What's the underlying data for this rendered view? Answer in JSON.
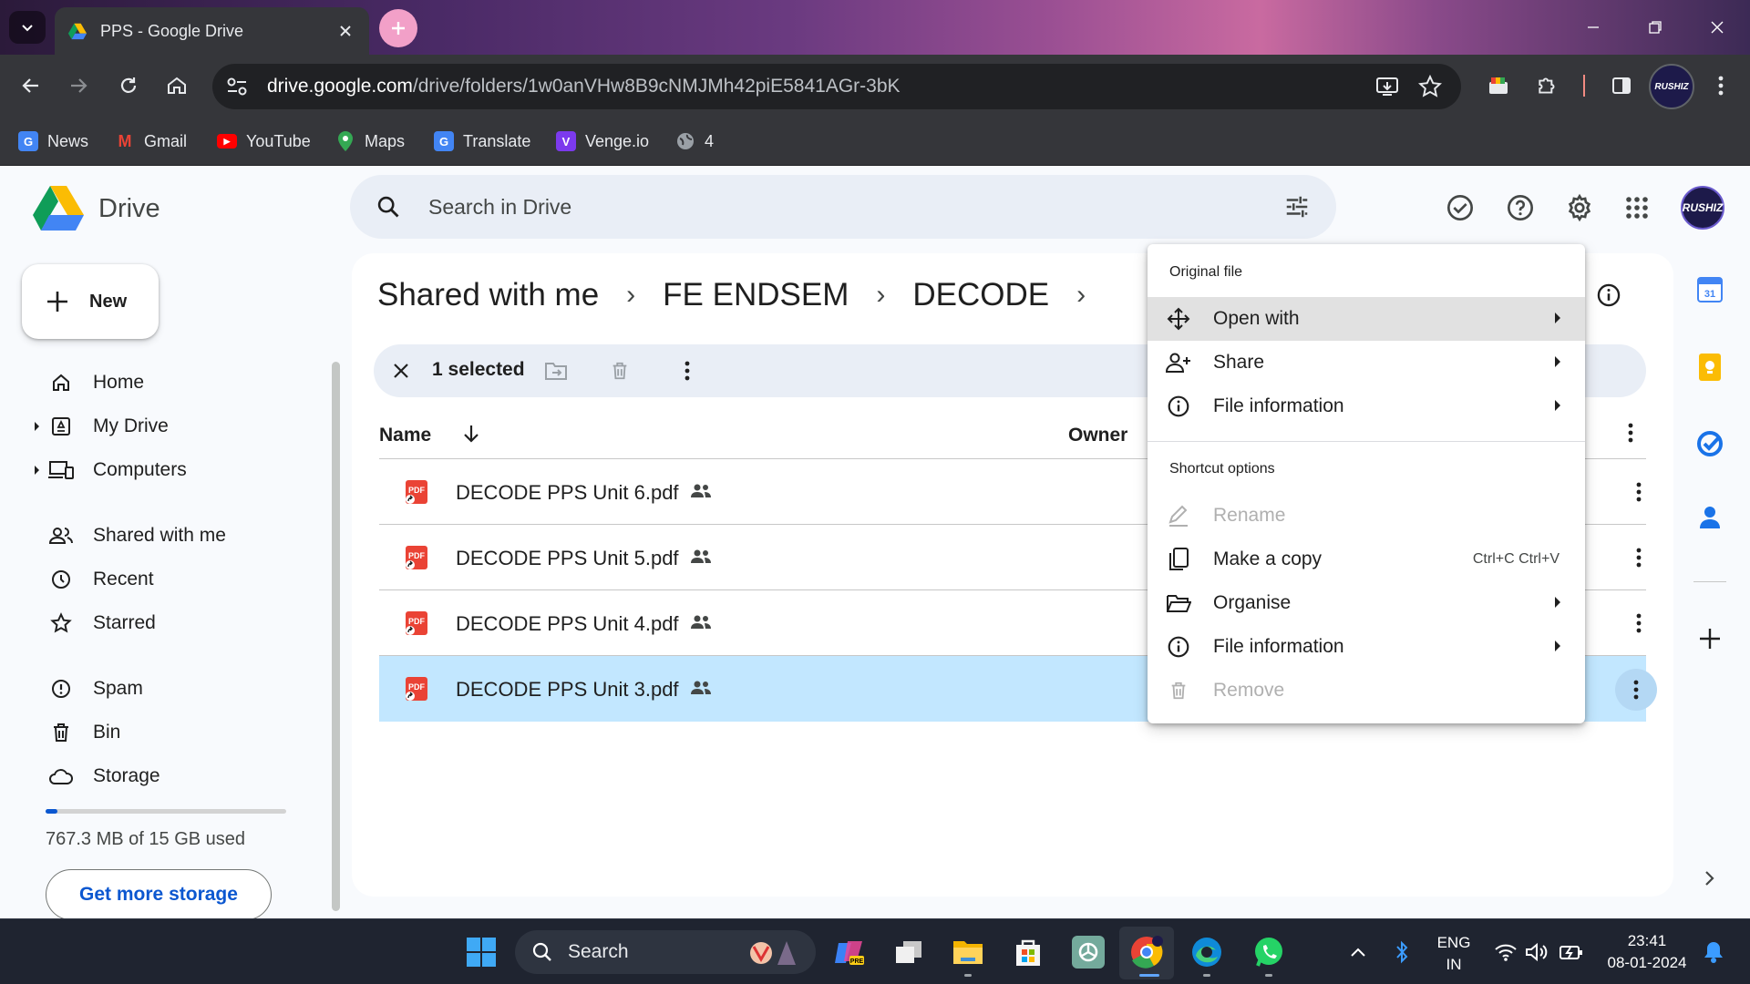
{
  "browser": {
    "tab_title": "PPS - Google Drive",
    "url_host": "drive.google.com",
    "url_path": "/drive/folders/1w0anVHw8B9cNMJMh42piE5841AGr-3bK",
    "profile_label": "RUSHIZ",
    "bookmarks": [
      {
        "label": "News",
        "icon": "news-icon",
        "color": "#4285f4"
      },
      {
        "label": "Gmail",
        "icon": "gmail-icon",
        "color": "#ea4335"
      },
      {
        "label": "YouTube",
        "icon": "youtube-icon",
        "color": "#ff0000"
      },
      {
        "label": "Maps",
        "icon": "maps-icon",
        "color": "#34a853"
      },
      {
        "label": "Translate",
        "icon": "translate-icon",
        "color": "#4285f4"
      },
      {
        "label": "Venge.io",
        "icon": "venge-icon",
        "color": "#7c3aed"
      },
      {
        "label": "4",
        "icon": "globe-icon",
        "color": "#9aa0a6"
      }
    ]
  },
  "drive": {
    "app_name": "Drive",
    "search_placeholder": "Search in Drive",
    "new_label": "New",
    "profile_label": "RUSHIZ",
    "nav": [
      {
        "label": "Home",
        "icon": "home-icon"
      },
      {
        "label": "My Drive",
        "icon": "my-drive-icon"
      },
      {
        "label": "Computers",
        "icon": "computers-icon"
      },
      {
        "label": "Shared with me",
        "icon": "shared-icon"
      },
      {
        "label": "Recent",
        "icon": "clock-icon"
      },
      {
        "label": "Starred",
        "icon": "star-icon"
      },
      {
        "label": "Spam",
        "icon": "spam-icon"
      },
      {
        "label": "Bin",
        "icon": "bin-icon"
      },
      {
        "label": "Storage",
        "icon": "cloud-icon"
      }
    ],
    "storage": {
      "used_text": "767.3 MB of 15 GB used",
      "used_fraction": 0.05,
      "cta": "Get more storage"
    },
    "breadcrumbs": [
      "Shared with me",
      "FE ENDSEM",
      "DECODE"
    ],
    "selection": {
      "count_label": "1 selected"
    },
    "columns": {
      "name": "Name",
      "owner": "Owner"
    },
    "files": [
      {
        "name": "DECODE PPS Unit 6.pdf",
        "selected": false
      },
      {
        "name": "DECODE PPS Unit 5.pdf",
        "selected": false
      },
      {
        "name": "DECODE PPS Unit 4.pdf",
        "selected": false
      },
      {
        "name": "DECODE PPS Unit 3.pdf",
        "selected": true
      }
    ]
  },
  "context_menu": {
    "section1_header": "Original file",
    "section1_items": [
      {
        "label": "Open with",
        "icon": "open-with-icon",
        "submenu": true,
        "hover": true
      },
      {
        "label": "Share",
        "icon": "share-person-icon",
        "submenu": true
      },
      {
        "label": "File information",
        "icon": "info-icon",
        "submenu": true
      }
    ],
    "section2_header": "Shortcut options",
    "section2_items": [
      {
        "label": "Rename",
        "icon": "rename-icon",
        "disabled": true
      },
      {
        "label": "Make a copy",
        "icon": "copy-icon",
        "shortcut": "Ctrl+C Ctrl+V"
      },
      {
        "label": "Organise",
        "icon": "folder-open-icon",
        "submenu": true
      },
      {
        "label": "File information",
        "icon": "info-icon",
        "submenu": true
      },
      {
        "label": "Remove",
        "icon": "bin-icon",
        "disabled": true
      }
    ]
  },
  "taskbar": {
    "search_label": "Search",
    "lang_line1": "ENG",
    "lang_line2": "IN",
    "time": "23:41",
    "date": "08-01-2024"
  },
  "colors": {
    "accent": "#0b57d0",
    "selected_row": "#c2e7ff",
    "pdf_red": "#ea4335"
  }
}
